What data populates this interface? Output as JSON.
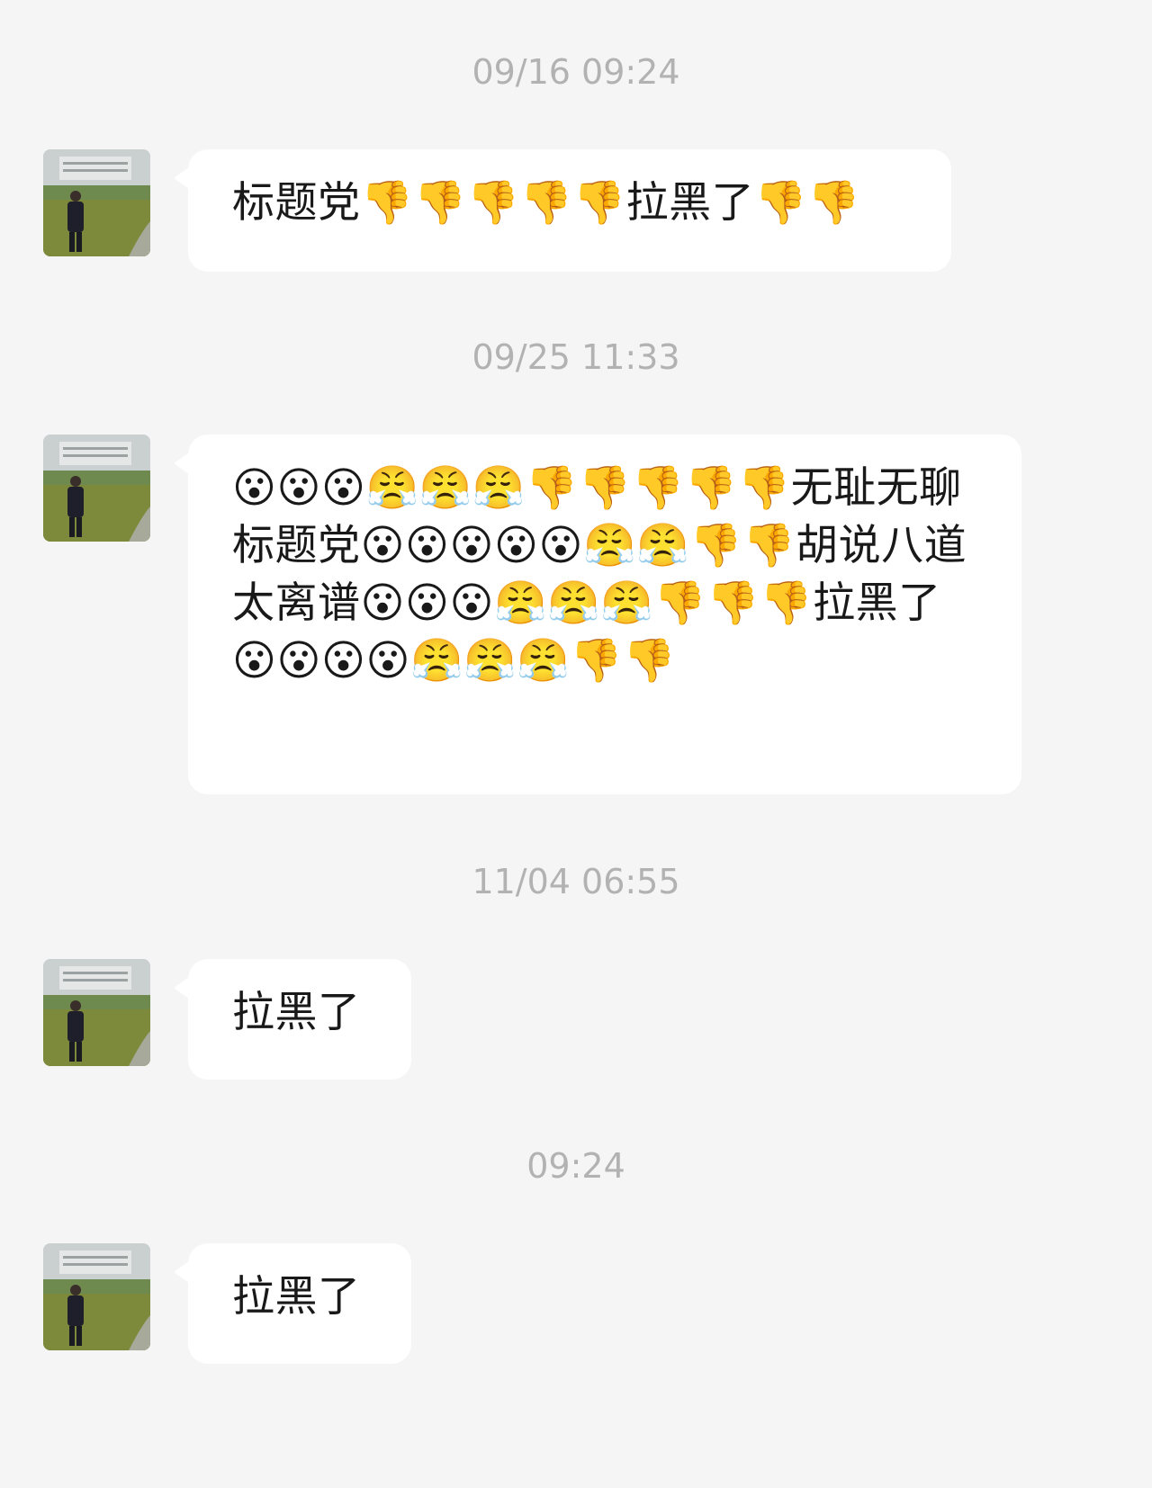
{
  "messages": [
    {
      "time": "09/16 09:24",
      "text": "标题党👎👎👎👎👎拉黑了👎👎"
    },
    {
      "time": "09/25 11:33",
      "text": "😮😮😮😤😤😤👎👎👎👎👎无耻无聊标题党😮😮😮😮😮😤😤👎👎胡说八道太离谱😮😮😮😤😤😤👎👎👎拉黑了😮😮😮😮😤😤😤👎👎"
    },
    {
      "time": "11/04 06:55",
      "text": "拉黑了"
    },
    {
      "time": "09:24",
      "text": "拉黑了"
    }
  ]
}
